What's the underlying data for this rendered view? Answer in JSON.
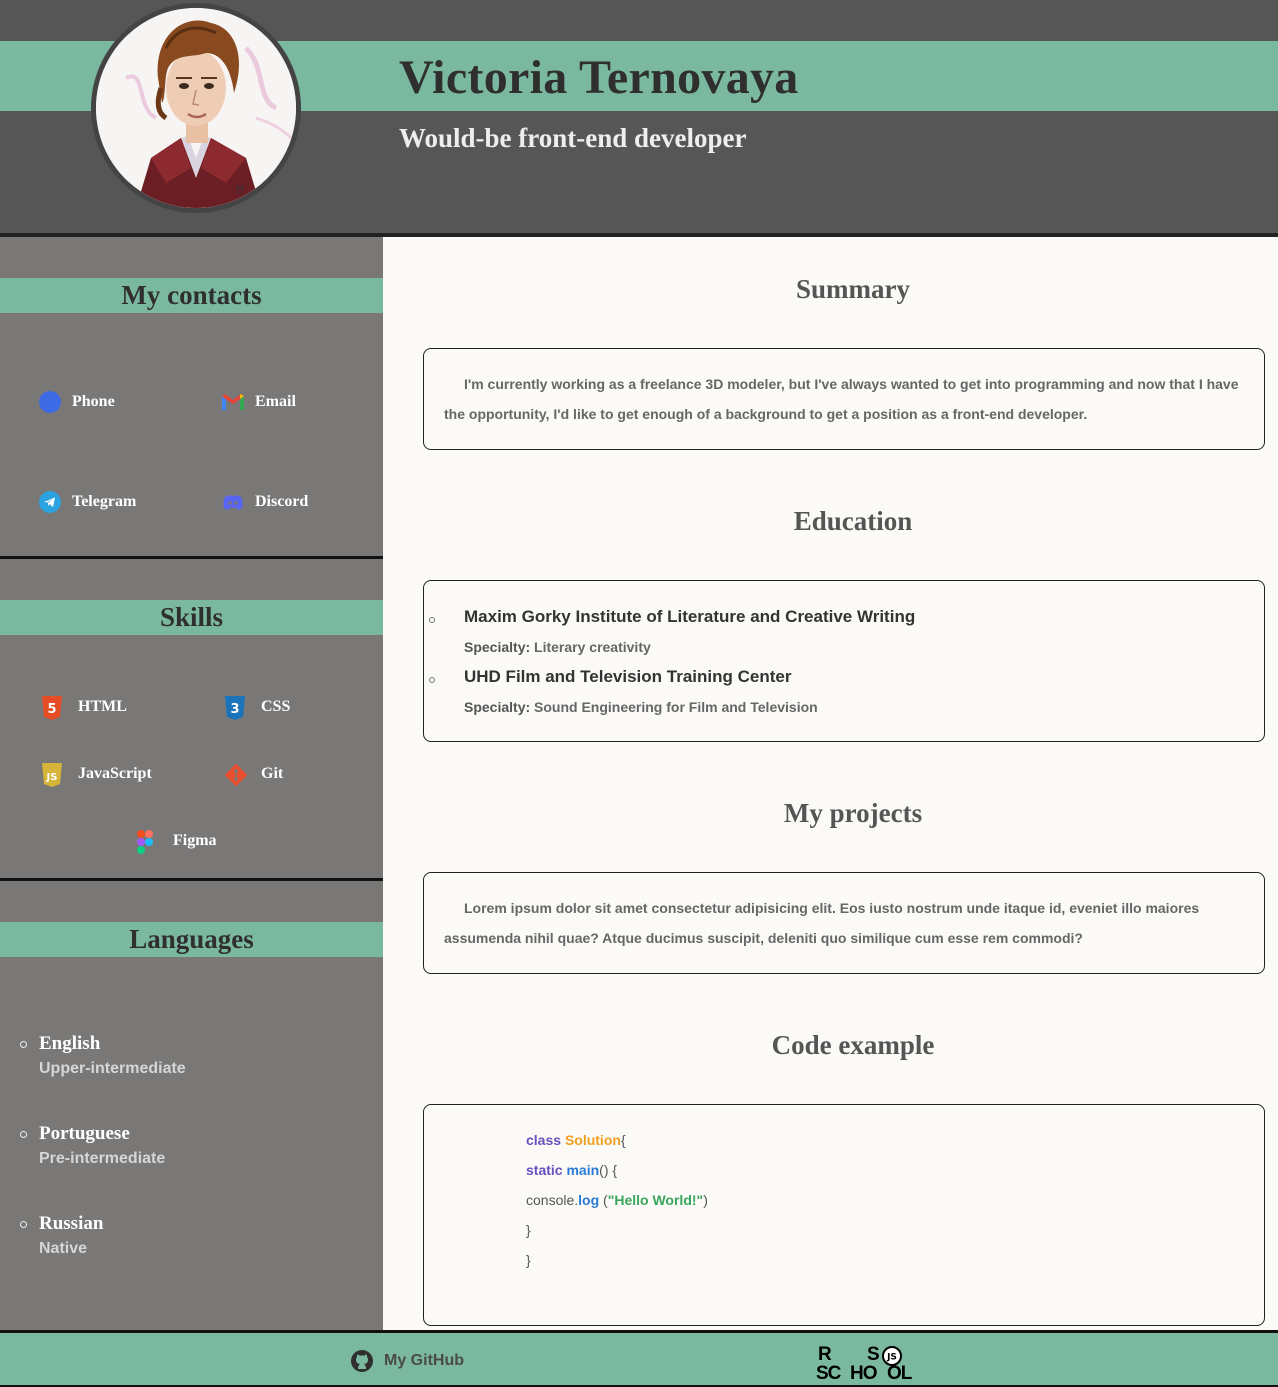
{
  "header": {
    "name": "Victoria Ternovaya",
    "subtitle": "Would-be front-end developer"
  },
  "sidebar": {
    "contacts": {
      "title": "My contacts",
      "items": [
        {
          "label": "Phone",
          "icon": "phone-icon"
        },
        {
          "label": "Email",
          "icon": "gmail-icon"
        },
        {
          "label": "Telegram",
          "icon": "telegram-icon"
        },
        {
          "label": "Discord",
          "icon": "discord-icon"
        }
      ]
    },
    "skills": {
      "title": "Skills",
      "items": [
        {
          "label": "HTML",
          "icon": "html5-icon"
        },
        {
          "label": "CSS",
          "icon": "css3-icon"
        },
        {
          "label": "JavaScript",
          "icon": "javascript-icon"
        },
        {
          "label": "Git",
          "icon": "git-icon"
        },
        {
          "label": "Figma",
          "icon": "figma-icon"
        }
      ]
    },
    "languages": {
      "title": "Languages",
      "items": [
        {
          "name": "English",
          "level": "Upper-intermediate"
        },
        {
          "name": "Portuguese",
          "level": "Pre-intermediate"
        },
        {
          "name": "Russian",
          "level": "Native"
        }
      ]
    }
  },
  "main": {
    "summary": {
      "title": "Summary",
      "text": "I'm currently working as a freelance 3D modeler, but I've always wanted to get into programming and now that I have the opportunity, I'd like to get enough of a background to get a position as a front-end developer."
    },
    "education": {
      "title": "Education",
      "specialty_label": "Specialty:",
      "items": [
        {
          "institution": "Maxim Gorky Institute of Literature and Creative Writing",
          "specialty": "Literary creativity"
        },
        {
          "institution": "UHD Film and Television Training Center",
          "specialty": "Sound Engineering for Film and Television"
        }
      ]
    },
    "projects": {
      "title": "My projects",
      "text": "Lorem ipsum dolor sit amet consectetur adipisicing elit. Eos iusto nostrum unde itaque id, eveniet illo maiores assumenda nihil quae? Atque ducimus suscipit, deleniti quo similique cum esse rem commodi?"
    },
    "code": {
      "title": "Code example",
      "kw_class": "class",
      "class_name": "Solution",
      "brace_open": "{",
      "kw_static": "static",
      "fn_main": "main",
      "main_rest": "() {",
      "console": "console.",
      "fn_log": "log",
      "paren_open": " (",
      "string": "\"Hello World!\"",
      "paren_close": ")",
      "brace_close": "}"
    }
  },
  "footer": {
    "github_label": "My GitHub",
    "school_logo": "RS School JS"
  },
  "colors": {
    "accent": "#7ab9a0",
    "header_bg": "#565656",
    "sidebar_bg": "#7a7876",
    "page_bg": "#fbfaf7"
  }
}
